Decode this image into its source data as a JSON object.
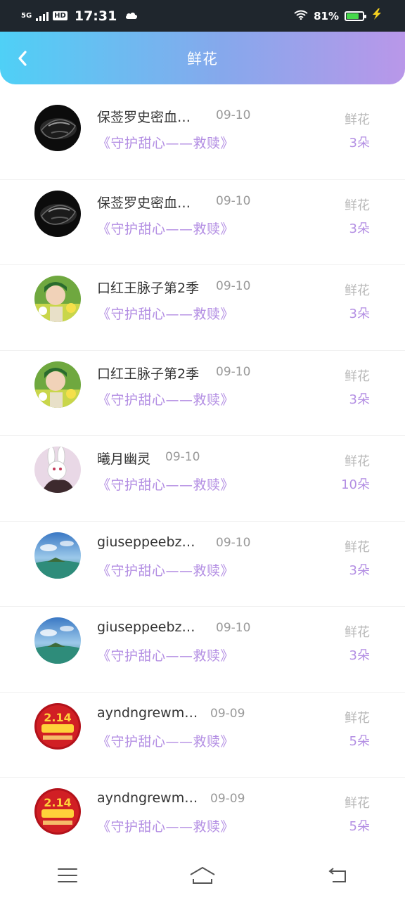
{
  "status_bar": {
    "network": "5G",
    "hd": "HD",
    "time": "17:31",
    "battery_text": "81%",
    "battery_level": 0.81,
    "cloud_icon": "cloud-icon",
    "wifi_icon": "wifi-icon",
    "charging_icon": "lightning-icon"
  },
  "header": {
    "title": "鲜花",
    "back_icon": "chevron-left-icon"
  },
  "colors": {
    "header_gradient_start": "#4fd0f6",
    "header_gradient_end": "#b997e9",
    "accent_purple": "#b38ee3",
    "muted_gray": "#999999"
  },
  "records": [
    {
      "name": "保莶罗史密血…",
      "date": "09-10",
      "book": "《守护甜心——救赎》",
      "gift_label": "鲜花",
      "gift_count": "3朵",
      "avatar": "black-helmet-avatar"
    },
    {
      "name": "保莶罗史密血…",
      "date": "09-10",
      "book": "《守护甜心——救赎》",
      "gift_label": "鲜花",
      "gift_count": "3朵",
      "avatar": "black-helmet-avatar"
    },
    {
      "name": "口红王脉子第2季",
      "date": "09-10",
      "book": "《守护甜心——救赎》",
      "gift_label": "鲜花",
      "gift_count": "3朵",
      "avatar": "girl-flowers-avatar"
    },
    {
      "name": "口红王脉子第2季",
      "date": "09-10",
      "book": "《守护甜心——救赎》",
      "gift_label": "鲜花",
      "gift_count": "3朵",
      "avatar": "girl-flowers-avatar"
    },
    {
      "name": "曦月幽灵",
      "date": "09-10",
      "book": "《守护甜心——救赎》",
      "gift_label": "鲜花",
      "gift_count": "10朵",
      "avatar": "white-rabbit-avatar"
    },
    {
      "name": "giuseppeebzan…",
      "date": "09-10",
      "book": "《守护甜心——救赎》",
      "gift_label": "鲜花",
      "gift_count": "3朵",
      "avatar": "sky-island-avatar"
    },
    {
      "name": "giuseppeebzan…",
      "date": "09-10",
      "book": "《守护甜心——救赎》",
      "gift_label": "鲜花",
      "gift_count": "3朵",
      "avatar": "sky-island-avatar"
    },
    {
      "name": "ayndngrewmarc",
      "date": "09-09",
      "book": "《守护甜心——救赎》",
      "gift_label": "鲜花",
      "gift_count": "5朵",
      "avatar": "red-festival-avatar"
    },
    {
      "name": "ayndngrewmarc",
      "date": "09-09",
      "book": "《守护甜心——救赎》",
      "gift_label": "鲜花",
      "gift_count": "5朵",
      "avatar": "red-festival-avatar"
    }
  ],
  "nav_bar": {
    "menu_icon": "menu-icon",
    "home_icon": "home-icon",
    "back_icon": "back-icon"
  }
}
